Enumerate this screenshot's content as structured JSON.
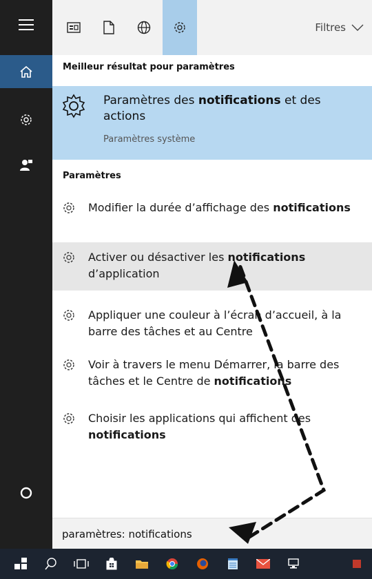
{
  "rail": {
    "items": [
      {
        "name": "hamburger-icon"
      },
      {
        "name": "home-icon"
      },
      {
        "name": "gear-icon"
      },
      {
        "name": "user-feedback-icon"
      },
      {
        "name": "cortana-circle-icon"
      }
    ]
  },
  "filter_bar": {
    "buttons": [
      {
        "name": "apps-filter-icon"
      },
      {
        "name": "documents-filter-icon"
      },
      {
        "name": "web-filter-icon"
      },
      {
        "name": "settings-filter-icon",
        "selected": true
      }
    ],
    "filters_label": "Filtres",
    "accent_color": "#a8cdea"
  },
  "best_match": {
    "heading": "Meilleur résultat pour paramètres",
    "title_plain_1": "Paramètres des ",
    "title_bold": "notifications",
    "title_plain_2": " et des actions",
    "subtitle": "Paramètres système",
    "highlight_color": "#b7d8f1"
  },
  "settings": {
    "heading": "Paramètres",
    "items": [
      {
        "t1": "Modifier la durée d’affichage des ",
        "b": "notifications",
        "t2": ""
      },
      {
        "t1": "Activer ou désactiver les ",
        "b": "notifications",
        "t2": " d’application",
        "hover": true
      },
      {
        "t1": "Appliquer une couleur à l’écran d’accueil, à la barre des tâches et au Centre",
        "b": "",
        "t2": ""
      },
      {
        "t1": "Voir à travers le menu Démarrer, la barre des tâches et le Centre de ",
        "b": "notifications",
        "t2": ""
      },
      {
        "t1": "Choisir les applications qui affichent des ",
        "b": "notifications",
        "t2": ""
      }
    ]
  },
  "search": {
    "value": "paramètres: notifications"
  },
  "taskbar": {
    "items": [
      "start-icon",
      "search-icon",
      "task-view-icon",
      "store-icon",
      "file-explorer-icon",
      "chrome-icon",
      "firefox-icon",
      "notepad-icon",
      "mail-icon",
      "network-icon"
    ]
  }
}
